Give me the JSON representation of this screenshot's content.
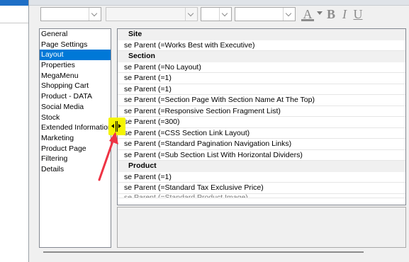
{
  "colors": {
    "selection": "#0078d7",
    "splitter_highlight": "#f4f400",
    "annotation_arrow": "#ee3344"
  },
  "toolbar": {
    "font_family_value": "",
    "font_style_value": "",
    "font_size_value": "",
    "color_value": "",
    "font_color_glyph": "A",
    "bold_glyph": "B",
    "italic_glyph": "I",
    "underline_glyph": "U"
  },
  "sidebar": {
    "items": [
      {
        "label": "General"
      },
      {
        "label": "Page Settings"
      },
      {
        "label": "Layout",
        "selected": true
      },
      {
        "label": "Properties"
      },
      {
        "label": "MegaMenu"
      },
      {
        "label": "Shopping Cart"
      },
      {
        "label": "Product - DATA"
      },
      {
        "label": "Social Media"
      },
      {
        "label": "Stock"
      },
      {
        "label": "Extended Information"
      },
      {
        "label": "Marketing"
      },
      {
        "label": "Product Page"
      },
      {
        "label": "Filtering"
      },
      {
        "label": "Details"
      }
    ]
  },
  "grid": {
    "rows": [
      {
        "type": "category",
        "text": "Site"
      },
      {
        "type": "value",
        "text": "se Parent (=Works Best with Executive)"
      },
      {
        "type": "category",
        "text": "Section"
      },
      {
        "type": "value",
        "text": "se Parent (=No Layout)"
      },
      {
        "type": "value",
        "text": "se Parent (=1)"
      },
      {
        "type": "value",
        "text": "se Parent (=1)"
      },
      {
        "type": "value",
        "text": "se Parent (=Section Page With Section Name At The Top)"
      },
      {
        "type": "value",
        "text": "se Parent (=Responsive Section Fragment List)"
      },
      {
        "type": "value",
        "text": "se Parent (=300)"
      },
      {
        "type": "value",
        "text": "se Parent (=CSS Section Link Layout)"
      },
      {
        "type": "value",
        "text": "se Parent (=Standard Pagination Navigation Links)"
      },
      {
        "type": "value",
        "text": "se Parent (=Sub Section List With Horizontal Dividers)"
      },
      {
        "type": "category",
        "text": "Product"
      },
      {
        "type": "value",
        "text": "se Parent (=1)"
      },
      {
        "type": "value",
        "text": "se Parent (=Standard Tax Exclusive Price)"
      },
      {
        "type": "clipped",
        "text": "se Parent (=Standard Product Image)"
      }
    ]
  }
}
